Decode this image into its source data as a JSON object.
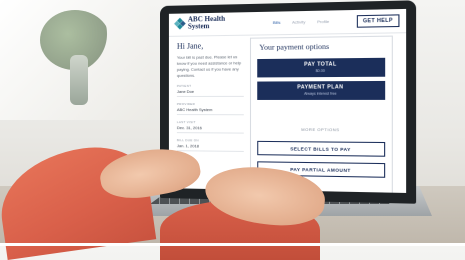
{
  "header": {
    "logo_line1": "ABC Health",
    "logo_line2": "System",
    "nav": [
      "Bills",
      "Activity",
      "Profile"
    ],
    "help_label": "GET HELP"
  },
  "left": {
    "greeting": "Hi Jane,",
    "message": "Your bill is past due. Please let us know if you need assistance or help paying. Contact us if you have any questions.",
    "fields": [
      {
        "label": "PATIENT",
        "value": "Jane Doe"
      },
      {
        "label": "PROVIDER",
        "value": "ABC Health System"
      },
      {
        "label": "LAST VISIT",
        "value": "Dec. 31, 2016"
      },
      {
        "label": "BILL DUE ON",
        "value": "Jan. 1, 2018"
      }
    ]
  },
  "payment": {
    "title": "Your payment options",
    "pay_total_label": "PAY TOTAL",
    "pay_total_amount": "$0.00",
    "payment_plan_label": "PAYMENT PLAN",
    "payment_plan_sub": "Always interest free",
    "more_options": "MORE OPTIONS",
    "select_bills": "SELECT BILLS TO PAY",
    "partial_amount": "PAY PARTIAL AMOUNT"
  },
  "colors": {
    "brand_navy": "#1b2e5a",
    "accent_teal": "#1e8a9a",
    "sleeve": "#d9604a"
  }
}
